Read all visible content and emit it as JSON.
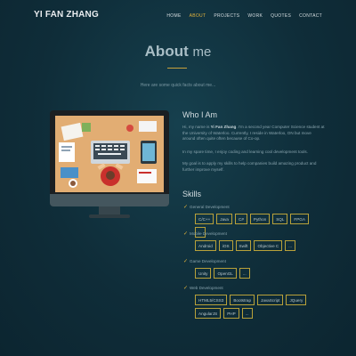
{
  "brand": "YI FAN ZHANG",
  "menu": [
    "HOME",
    "ABOUT",
    "PROJECTS",
    "WORK",
    "QUOTES",
    "CONTACT"
  ],
  "active_menu": "ABOUT",
  "title": {
    "strong": "About",
    "light": "me"
  },
  "subtitle": "Here are some quick facts about me...",
  "who": {
    "heading": "Who I Am",
    "intro_prefix": "Hi, my name is ",
    "name": "Yi Fan Zhang",
    "intro_suffix": ". I'm a second year Computer Science student at the University of Waterloo. Currently, I reside in Waterloo, ON but move around often quite often because of Co-op.",
    "p2": "In my spare time, I enjoy coding and learning cool development tools.",
    "p3": "My goal is to apply my skills to help companies build amazing product and further improve myself."
  },
  "skills": {
    "heading": "Skills",
    "categories": [
      {
        "name": "General Development",
        "tags": [
          "C/C++",
          "Java",
          "C#",
          "Python",
          "SQL",
          "FPGA",
          "..."
        ]
      },
      {
        "name": "Mobile Development",
        "tags": [
          "Android",
          "iOS",
          "Swift",
          "Objective C",
          "..."
        ]
      },
      {
        "name": "Game Development",
        "tags": [
          "Unity",
          "OpenGL",
          "..."
        ]
      },
      {
        "name": "Web Development",
        "tags": [
          "HTML5/CSS3",
          "Bootstrap",
          "JavaScript",
          "JQuery",
          "AngularJS",
          "PHP",
          "..."
        ]
      }
    ]
  },
  "colors": {
    "background": "#0f2b36",
    "accent": "#e0b23c",
    "text": "#89a4ae"
  }
}
